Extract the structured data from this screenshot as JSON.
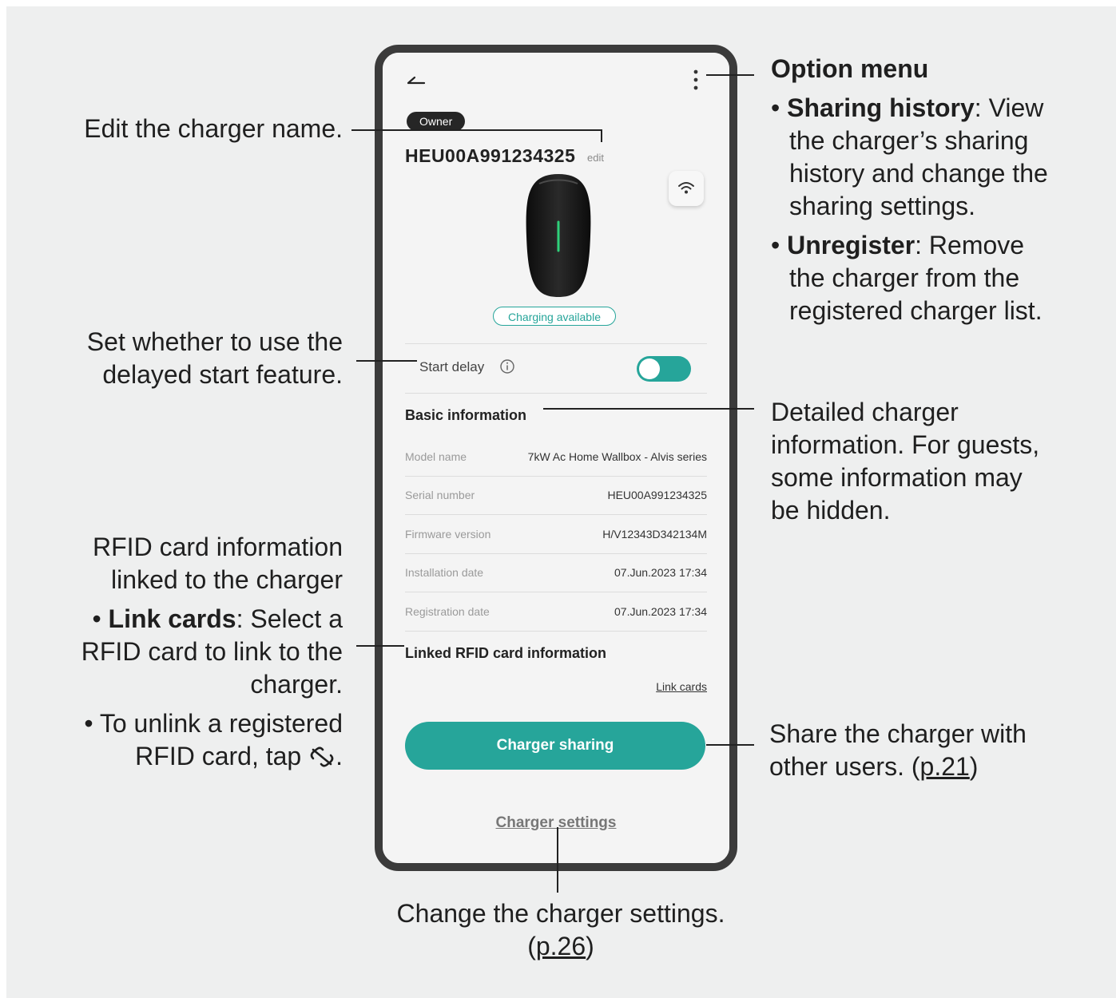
{
  "phone": {
    "owner_badge": "Owner",
    "charger_name": "HEU00A991234325",
    "edit_label": "edit",
    "status": "Charging available",
    "start_delay_label": "Start delay",
    "start_delay_on": true,
    "basic_info_title": "Basic information",
    "basic_info_rows": [
      {
        "label": "Model name",
        "value": "7kW Ac Home Wallbox - Alvis series"
      },
      {
        "label": "Serial number",
        "value": "HEU00A991234325"
      },
      {
        "label": "Firmware version",
        "value": "H/V12343D342134M"
      },
      {
        "label": "Installation date",
        "value": "07.Jun.2023 17:34"
      },
      {
        "label": "Registration date",
        "value": "07.Jun.2023 17:34"
      }
    ],
    "rfid_title": "Linked RFID card information",
    "link_cards_label": "Link cards",
    "share_button": "Charger sharing",
    "settings_link": "Charger settings"
  },
  "callouts": {
    "edit_name": "Edit the charger name.",
    "start_delay_1": "Set whether to use the",
    "start_delay_2": "delayed start feature.",
    "rfid_1": "RFID card information",
    "rfid_2": "linked to the charger",
    "rfid_link_bold": "Link cards",
    "rfid_link_rest_1": ": Select a",
    "rfid_link_rest_2": "RFID card to link to the",
    "rfid_link_rest_3": "charger.",
    "rfid_unlink_1": "To unlink a registered",
    "rfid_unlink_2": "RFID card, tap",
    "option_menu_title": "Option menu",
    "sharing_history_bold": "Sharing history",
    "sharing_history_1": ": View",
    "sharing_history_2": "the charger’s sharing",
    "sharing_history_3": "history and change the",
    "sharing_history_4": "sharing settings.",
    "unregister_bold": "Unregister",
    "unregister_1": ": Remove",
    "unregister_2": "the charger from the",
    "unregister_3": "registered charger list.",
    "detail_1": "Detailed charger",
    "detail_2": "information. For guests,",
    "detail_3": "some information may",
    "detail_4": "be hidden.",
    "share_1": "Share the charger with",
    "share_2": "other users. (",
    "share_page": "p.21",
    "share_close": ")",
    "settings_1": "Change the charger settings.",
    "settings_open": "(",
    "settings_page": "p.26",
    "settings_close": ")"
  },
  "colors": {
    "accent": "#26a59a",
    "frame": "#3b3b3b",
    "background": "#eeefef"
  }
}
